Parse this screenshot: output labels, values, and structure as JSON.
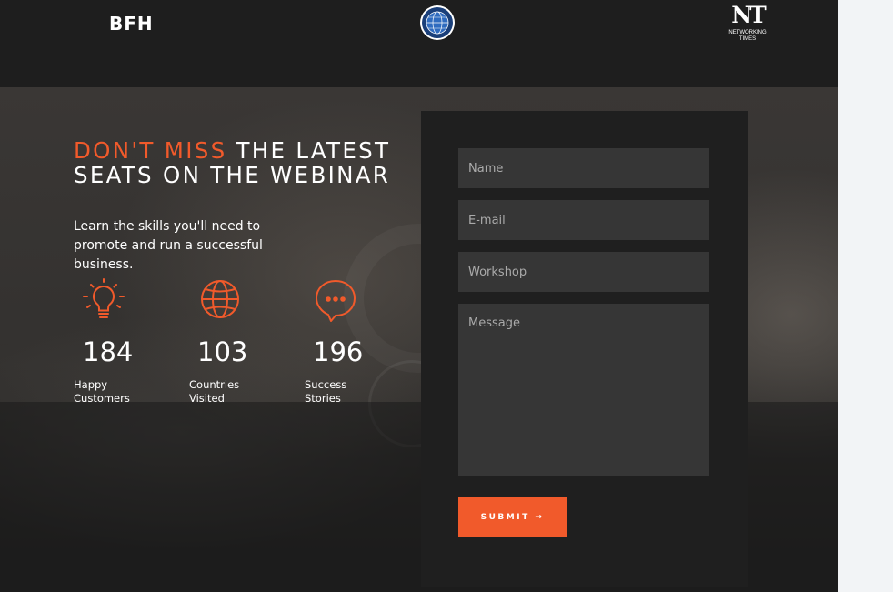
{
  "header": {
    "logo_left": "BFH",
    "logo_right_mark": "NT",
    "logo_right_text_line1": "NETWORKING",
    "logo_right_text_line2": "TIMES",
    "seal_icon": "globe-seal-icon"
  },
  "hero": {
    "headline_accent": "DON'T MISS",
    "headline_rest_line1": " THE LATEST",
    "headline_line2": "SEATS ON THE WEBINAR",
    "subtitle": "Learn the skills you'll need to promote and run a successful business.",
    "accent_color": "#f15a2b"
  },
  "stats": [
    {
      "icon": "lightbulb-icon",
      "value": "184",
      "label_line1": "Happy",
      "label_line2": "Customers"
    },
    {
      "icon": "globe-icon",
      "value": "103",
      "label_line1": "Countries",
      "label_line2": "Visited"
    },
    {
      "icon": "chat-bubble-icon",
      "value": "196",
      "label_line1": "Success",
      "label_line2": "Stories"
    }
  ],
  "form": {
    "name_placeholder": "Name",
    "email_placeholder": "E-mail",
    "workshop_placeholder": "Workshop",
    "message_placeholder": "Message",
    "submit_label": "SUBMIT →"
  }
}
